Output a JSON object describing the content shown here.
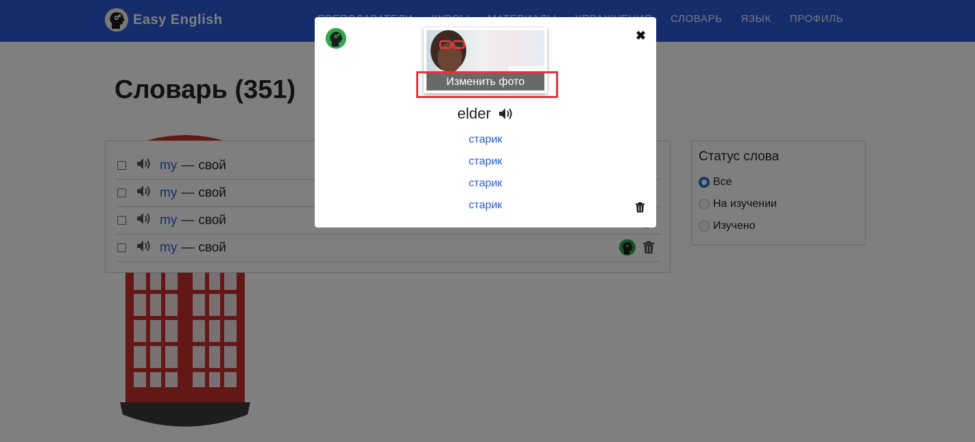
{
  "brand": {
    "name": "Easy English"
  },
  "nav": {
    "items": [
      "ПРЕПОДАВАТЕЛИ",
      "КУРСЫ",
      "МАТЕРИАЛЫ",
      "УПРАЖНЕНИЯ",
      "СЛОВАРЬ",
      "ЯЗЫК",
      "ПРОФИЛЬ"
    ]
  },
  "page": {
    "title": "Словарь (351)"
  },
  "words": [
    {
      "en": "my",
      "sep": "—",
      "ru": "свой"
    },
    {
      "en": "my",
      "sep": "—",
      "ru": "свой"
    },
    {
      "en": "my",
      "sep": "—",
      "ru": "свой"
    },
    {
      "en": "my",
      "sep": "—",
      "ru": "свой"
    }
  ],
  "status": {
    "title": "Статус слова",
    "options": [
      {
        "label": "Все",
        "checked": true
      },
      {
        "label": "На изучении",
        "checked": false
      },
      {
        "label": "Изучено",
        "checked": false
      }
    ]
  },
  "modal": {
    "close_glyph": "✖",
    "photo_button": "Изменить фото",
    "word": "elder",
    "translations": [
      "старик",
      "старик",
      "старик",
      "старик"
    ]
  },
  "colors": {
    "primary": "#2a5bd7",
    "link": "#2a5bd7",
    "highlight": "#e4343a",
    "logo_green": "#2ea84a"
  }
}
